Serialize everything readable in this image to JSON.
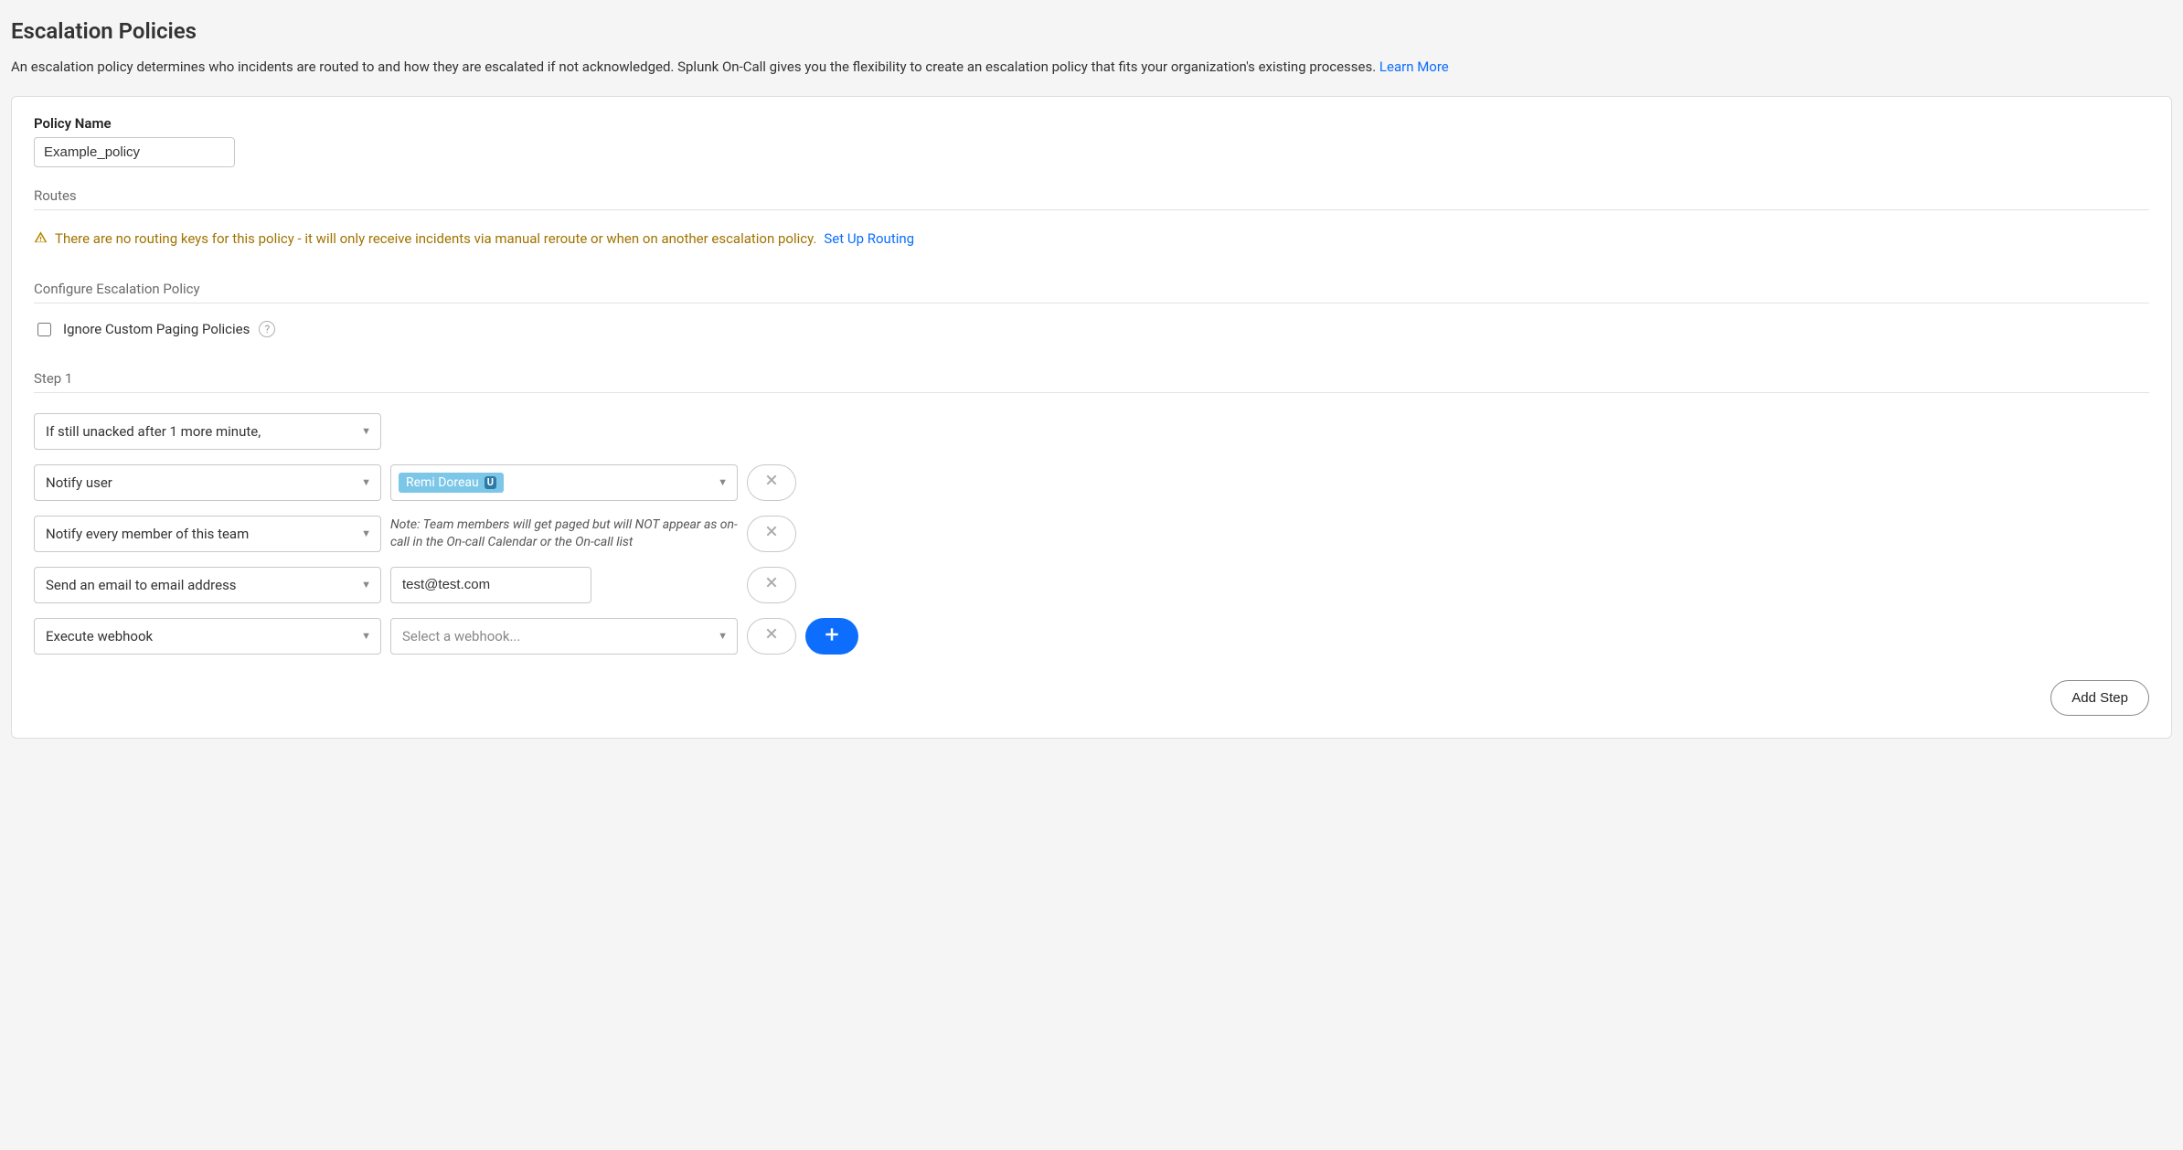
{
  "header": {
    "title": "Escalation Policies",
    "description": "An escalation policy determines who incidents are routed to and how they are escalated if not acknowledged. Splunk On-Call gives you the flexibility to create an escalation policy that fits your organization's existing processes. ",
    "learn_more": "Learn More"
  },
  "policy": {
    "name_label": "Policy Name",
    "name_value": "Example_policy"
  },
  "routes": {
    "section_label": "Routes",
    "warning_text": "There are no routing keys for this policy - it will only receive incidents via manual reroute or when on another escalation policy.",
    "setup_link": "Set Up Routing"
  },
  "configure": {
    "section_label": "Configure Escalation Policy",
    "ignore_label": "Ignore Custom Paging Policies",
    "ignore_checked": false
  },
  "step": {
    "label": "Step 1",
    "condition": "If still unacked after 1 more minute,",
    "actions": [
      {
        "type_label": "Notify user",
        "user_chip": "Remi Doreau",
        "user_badge": "U"
      },
      {
        "type_label": "Notify every member of this team",
        "note": "Note: Team members will get paged but will NOT appear as on-call in the On-call Calendar or the On-call list"
      },
      {
        "type_label": "Send an email to email address",
        "email_value": "test@test.com"
      },
      {
        "type_label": "Execute webhook",
        "webhook_placeholder": "Select a webhook..."
      }
    ],
    "add_step_label": "Add Step"
  },
  "icons": {
    "warning": "warning-icon",
    "help": "help-icon",
    "caret": "chevron-down-icon",
    "close": "close-icon",
    "plus": "plus-icon"
  }
}
